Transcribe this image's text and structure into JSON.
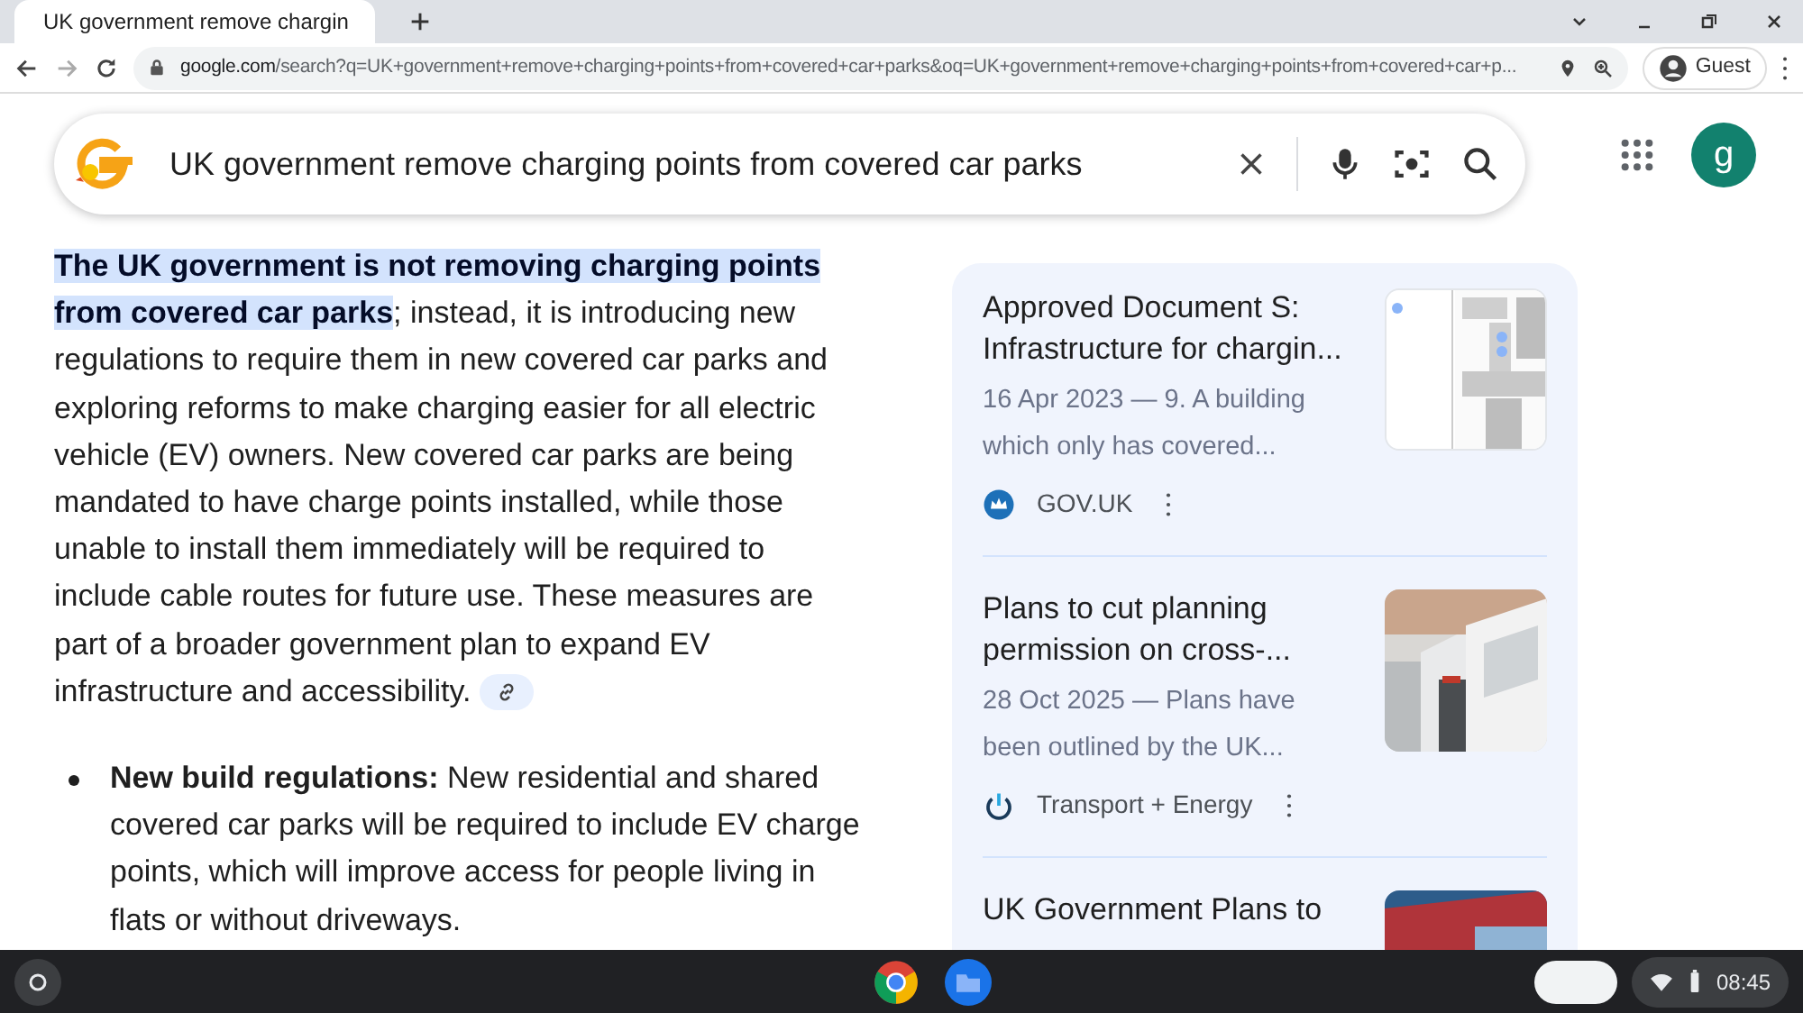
{
  "browser": {
    "tab_title": "UK government remove chargin",
    "url_host": "google.com",
    "url_path": "/search?q=UK+government+remove+charging+points+from+covered+car+parks&oq=UK+government+remove+charging+points+from+covered+car+p...",
    "profile": "Guest"
  },
  "search": {
    "query": "UK government remove charging points from covered car parks"
  },
  "account": {
    "letter": "g"
  },
  "answer": {
    "paragraph": "**The UK government is not removing charging points from covered car parks**; instead, it is introducing new regulations to require them in new covered car parks and exploring reforms to make charging easier for all electric vehicle (EV) owners. New covered car parks are being mandated to have charge points installed, while those unable to install them immediately will be required to include cable routes for future use. These measures are part of a broader government plan to expand EV infrastructure and accessibility.",
    "bullets": [
      "**New build regulations:** New residential and shared covered car parks will be required to include EV charge points, which will improve access for people living in flats or without driveways."
    ]
  },
  "sources": [
    {
      "title": "Approved Document S: Infrastructure for chargin...",
      "snippet": "16 Apr 2023 — 9. A building which only has covered...",
      "site": "GOV.UK"
    },
    {
      "title": "Plans to cut planning permission on cross-...",
      "snippet": "28 Oct 2025 — Plans have been outlined by the UK...",
      "site": "Transport + Energy"
    },
    {
      "title": "UK Government Plans to"
    }
  ],
  "shelf": {
    "time": "08:45"
  }
}
